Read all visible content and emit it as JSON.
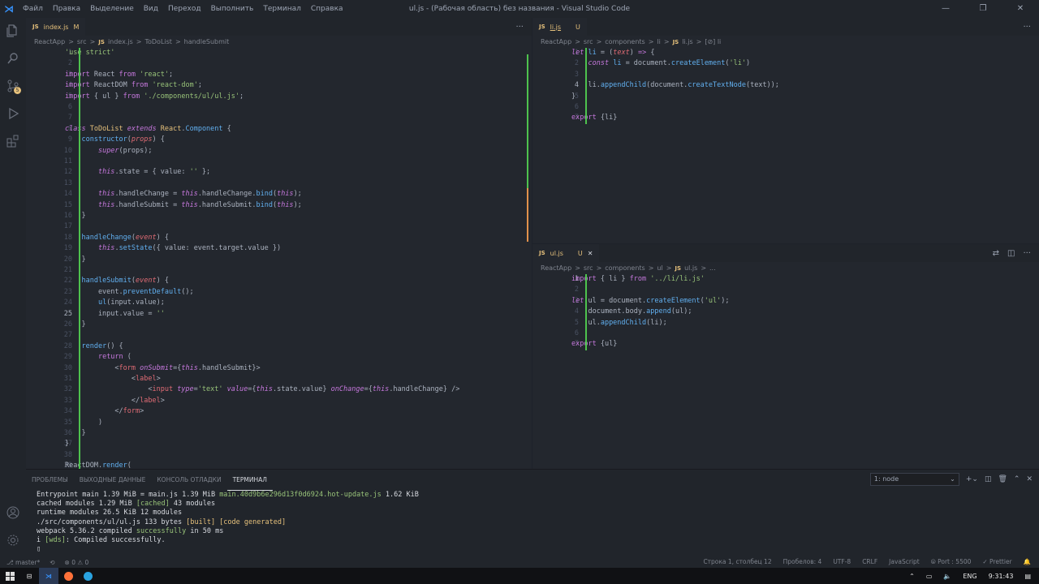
{
  "window": {
    "title": "ul.js - (Рабочая область) без названия - Visual Studio Code",
    "menu": [
      "Файл",
      "Правка",
      "Выделение",
      "Вид",
      "Переход",
      "Выполнить",
      "Терминал",
      "Справка"
    ]
  },
  "left_editor": {
    "tab": {
      "icon": "JS",
      "label": "index.js",
      "modified": "M"
    },
    "breadcrumb": [
      "ReactApp",
      ">",
      "src",
      ">",
      "JS",
      "index.js",
      ">",
      "ToDoList",
      ">",
      "handleSubmit"
    ]
  },
  "right_top_editor": {
    "tab": {
      "icon": "JS",
      "label": "li.js",
      "status": "U"
    },
    "breadcrumb": [
      "ReactApp",
      ">",
      "src",
      ">",
      "components",
      ">",
      "li",
      ">",
      "JS",
      "li.js",
      ">",
      "[⊘] li"
    ]
  },
  "right_bottom_editor": {
    "tab": {
      "icon": "JS",
      "label": "ul.js",
      "status": "U",
      "close": "✕"
    },
    "breadcrumb": [
      "ReactApp",
      ">",
      "src",
      ">",
      "components",
      ">",
      "ul",
      ">",
      "JS",
      "ul.js",
      ">",
      "..."
    ]
  },
  "panel": {
    "tabs": [
      "ПРОБЛЕМЫ",
      "ВЫХОДНЫЕ ДАННЫЕ",
      "КОНСОЛЬ ОТЛАДКИ",
      "ТЕРМИНАЛ"
    ],
    "terminal_select": "1: node",
    "lines": [
      {
        "parts": [
          [
            "Entrypoint main 1.39 MiB = ",
            ""
          ],
          [
            "main.js",
            ""
          ],
          [
            " 1.39 MiB ",
            ""
          ],
          [
            "main.40d9b6e296d13f0d6924.hot-update.js",
            "tg"
          ],
          [
            " 1.62 KiB",
            ""
          ]
        ]
      },
      {
        "parts": [
          [
            "cached modules 1.29 MiB ",
            ""
          ],
          [
            "[cached]",
            "tg"
          ],
          [
            " 43 modules",
            ""
          ]
        ]
      },
      {
        "parts": [
          [
            "runtime modules 26.5 KiB 12 modules",
            ""
          ]
        ]
      },
      {
        "parts": [
          [
            "./src/components/ul/ul.js 133 bytes ",
            ""
          ],
          [
            "[built]",
            "ty"
          ],
          [
            " ",
            ""
          ],
          [
            "[code generated]",
            "ty"
          ]
        ]
      },
      {
        "parts": [
          [
            "webpack 5.36.2 compiled ",
            ""
          ],
          [
            "successfully",
            "tg"
          ],
          [
            " in 50 ms",
            ""
          ]
        ]
      },
      {
        "parts": [
          [
            "i ",
            ""
          ],
          [
            "[wds]",
            "tg"
          ],
          [
            ": Compiled successfully.",
            ""
          ]
        ]
      },
      {
        "parts": [
          [
            "▯",
            ""
          ]
        ]
      }
    ]
  },
  "statusbar": {
    "left": [
      "⎇ master*",
      "⟲",
      "⊗ 0 ⚠ 0"
    ],
    "right": [
      "Строка 1, столбец 12",
      "Пробелов: 4",
      "UTF-8",
      "CRLF",
      "JavaScript",
      "⦾ Port : 5500",
      "✓ Prettier",
      "🔔"
    ]
  },
  "taskbar": {
    "lang": "ENG",
    "time": "9:31:43"
  },
  "colors": {
    "accent": "#3794ff",
    "modified": "#e5c07b",
    "added_gutter": "#4ec24e",
    "changed_gutter": "#e2914b"
  }
}
